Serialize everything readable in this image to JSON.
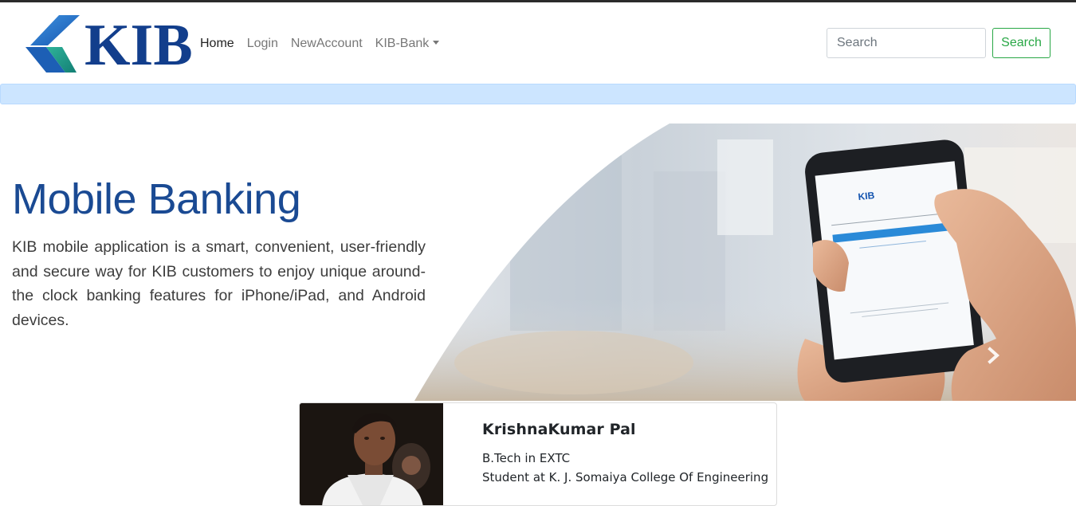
{
  "brand": {
    "logo_text": "KIB",
    "colors": {
      "blue": "#123e8c",
      "light_blue": "#2a7fd0",
      "teal": "#1e9a8a"
    }
  },
  "nav": {
    "items": [
      {
        "label": "Home",
        "active": true
      },
      {
        "label": "Login",
        "active": false
      },
      {
        "label": "NewAccount",
        "active": false
      },
      {
        "label": "KIB-Bank",
        "active": false,
        "dropdown": true
      }
    ]
  },
  "search": {
    "placeholder": "Search",
    "button_label": "Search",
    "button_color": "#28a745"
  },
  "alert": {
    "text": "",
    "color": "#cce5ff"
  },
  "hero": {
    "title": "Mobile Banking",
    "description": "KIB mobile application is a smart, convenient, user-friendly and secure way for KIB customers to enjoy unique around-the clock banking features for iPhone/iPad, and Android devices.",
    "phone_app_logo": "KIB",
    "next_icon": "chevron-right-icon"
  },
  "profile": {
    "name": "KrishnaKumar Pal",
    "degree": "B.Tech in EXTC",
    "school": "Student at K. J. Somaiya College Of Engineering"
  }
}
